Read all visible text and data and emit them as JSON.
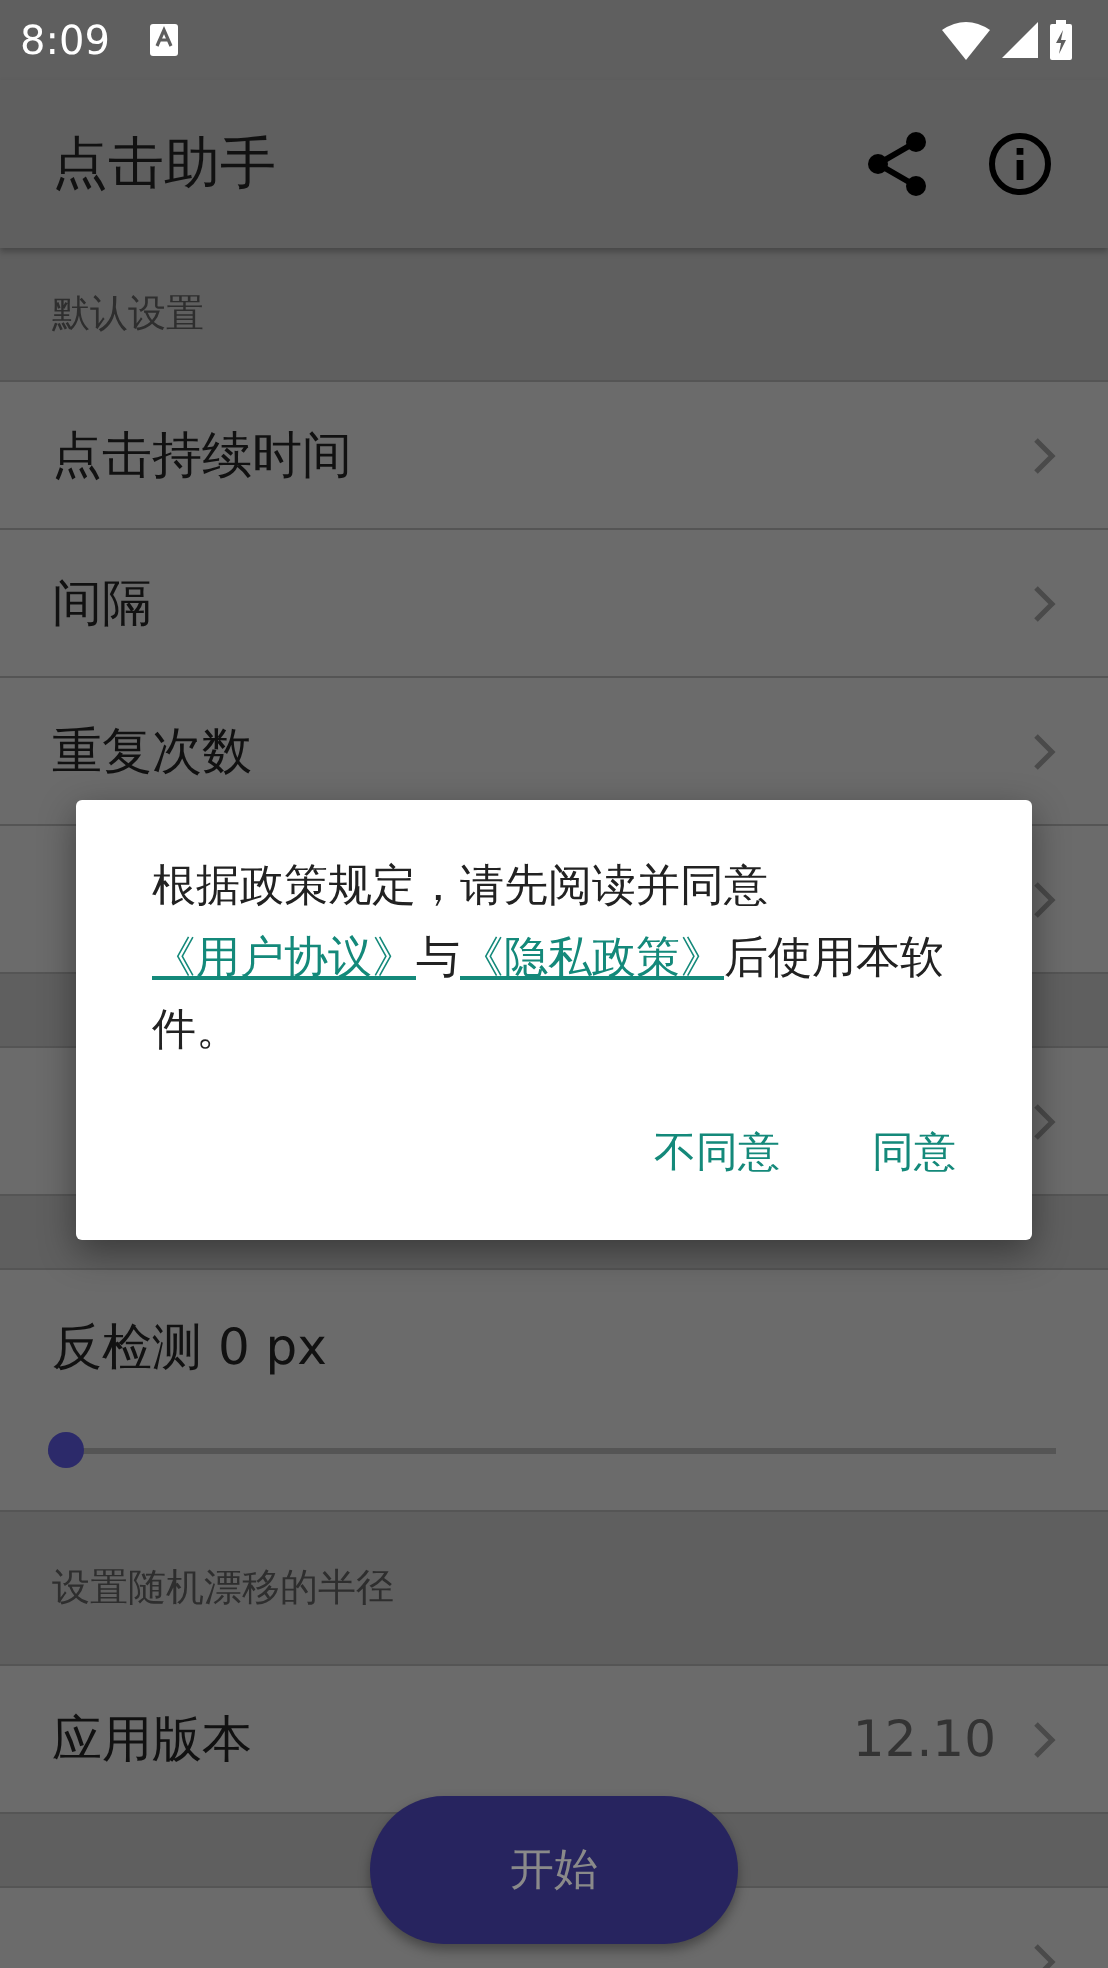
{
  "status_bar": {
    "time": "8:09"
  },
  "app_bar": {
    "title": "点击助手"
  },
  "list": [
    {
      "kind": "header",
      "text": "默认设置"
    },
    {
      "kind": "row",
      "label": "点击持续时间"
    },
    {
      "kind": "row",
      "label": "间隔"
    },
    {
      "kind": "row",
      "label": "重复次数"
    },
    {
      "kind": "row"
    },
    {
      "kind": "gap"
    },
    {
      "kind": "row"
    },
    {
      "kind": "gap"
    },
    {
      "kind": "slider",
      "label": "反检测 0 px",
      "level": 0
    },
    {
      "kind": "note",
      "text": "设置随机漂移的半径"
    },
    {
      "kind": "row",
      "label": "应用版本",
      "value": "12.10"
    },
    {
      "kind": "gap"
    },
    {
      "kind": "row"
    }
  ],
  "fab": {
    "label": "开始"
  },
  "dialog": {
    "message": [
      {
        "text": "根据政策规定，请先阅读并同意",
        "link": false
      },
      {
        "text": "《用户协议》",
        "link": true
      },
      {
        "text": "与",
        "link": false
      },
      {
        "text": "《隐私政策》",
        "link": true
      },
      {
        "text": "后使用本软件。",
        "link": false
      }
    ],
    "buttons": [
      "不同意",
      "同意"
    ]
  }
}
